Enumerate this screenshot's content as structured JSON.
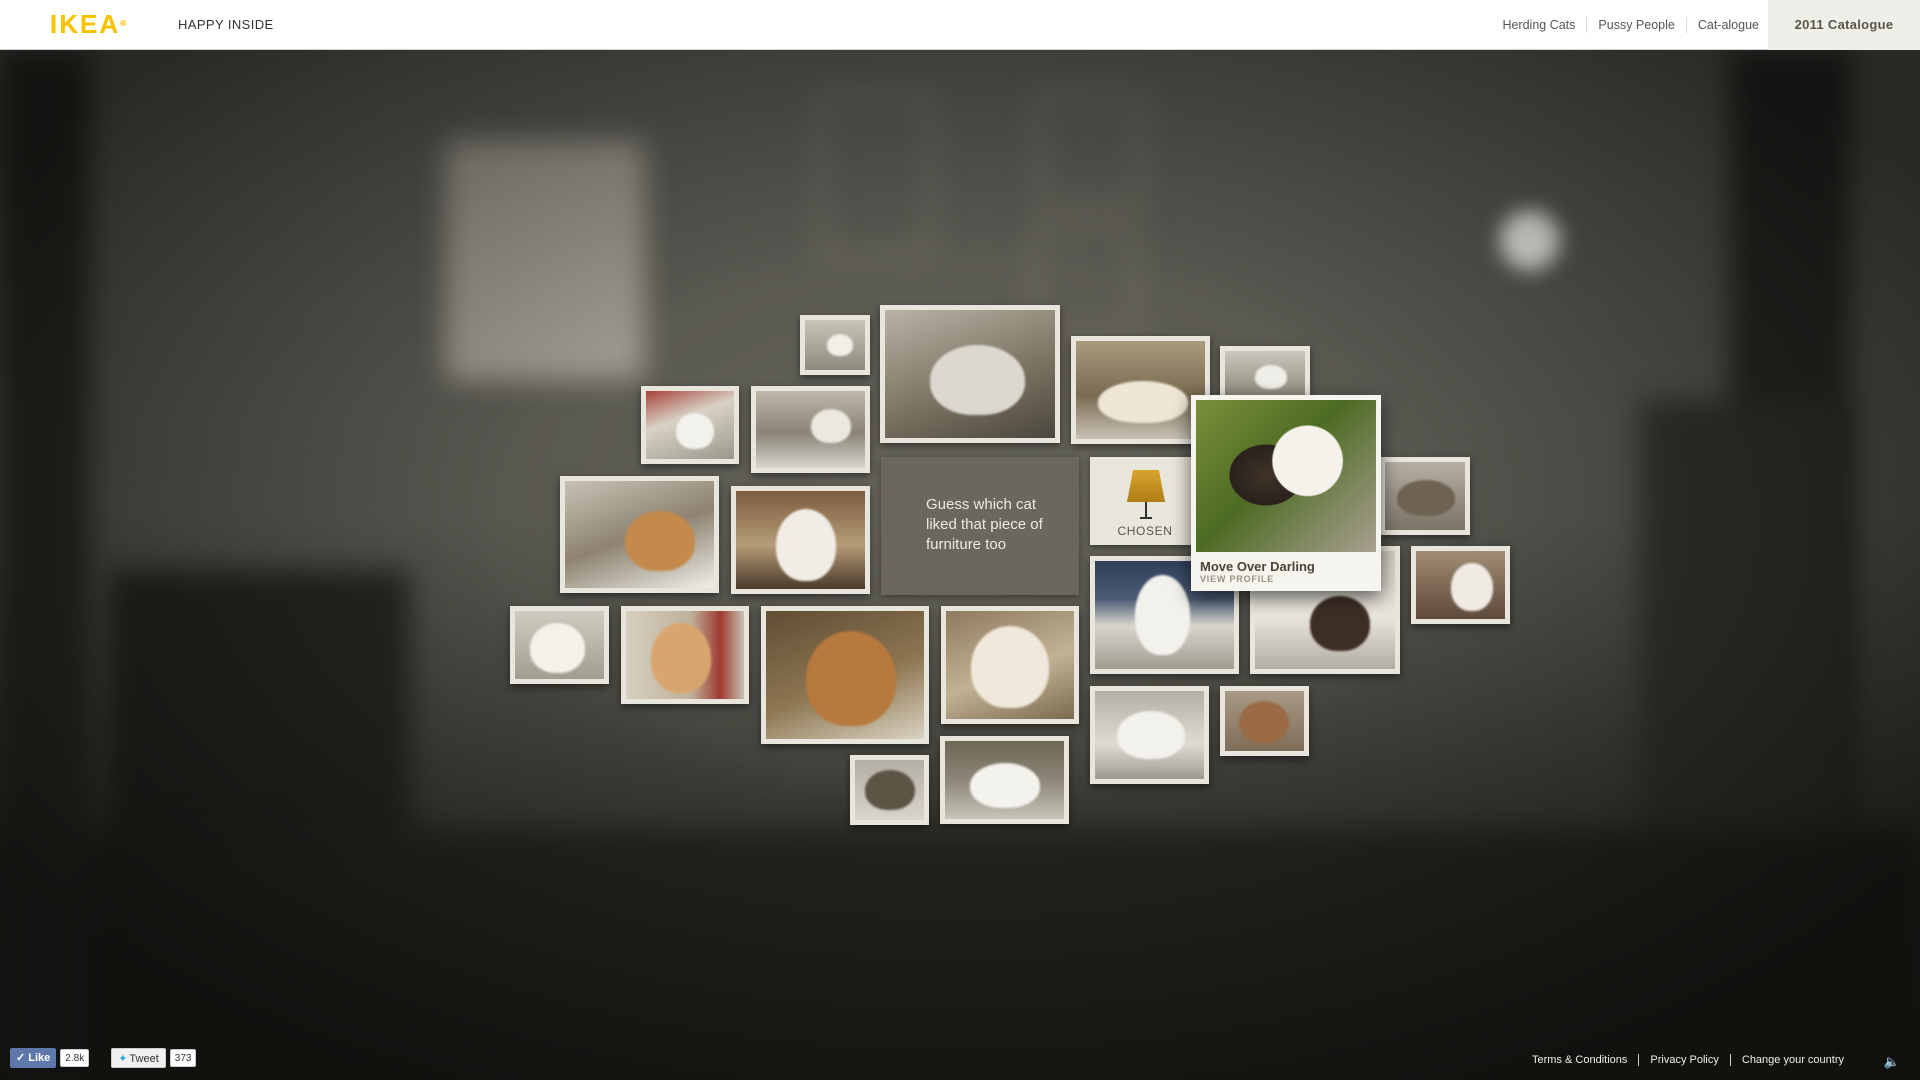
{
  "header": {
    "logo": "IKEA",
    "tagline": "HAPPY INSIDE",
    "nav": [
      "Herding Cats",
      "Pussy People",
      "Cat-alogue"
    ],
    "catalogue": "2011 Catalogue"
  },
  "grid": {
    "prompt": "Guess which cat liked that piece of furniture too",
    "chosen_label": "CHOSEN",
    "profile": {
      "name": "Move Over Darling",
      "link": "VIEW PROFILE"
    }
  },
  "social": {
    "like": "Like",
    "like_count": "2.8k",
    "tweet": "Tweet",
    "tweet_count": "373"
  },
  "footer": {
    "links": [
      "Terms & Conditions",
      "Privacy Policy",
      "Change your country"
    ]
  },
  "icons": {
    "sound": "speaker-icon",
    "facebook": "thumbs-up-icon",
    "twitter": "bird-icon"
  },
  "colors": {
    "logo": "#f5c400",
    "header_bg": "#ffffff",
    "catalogue_bg": "#efefea",
    "tile_frame": "#e8e6dc",
    "facebook": "#5f78ab",
    "twitter": "#2fa7dd"
  }
}
